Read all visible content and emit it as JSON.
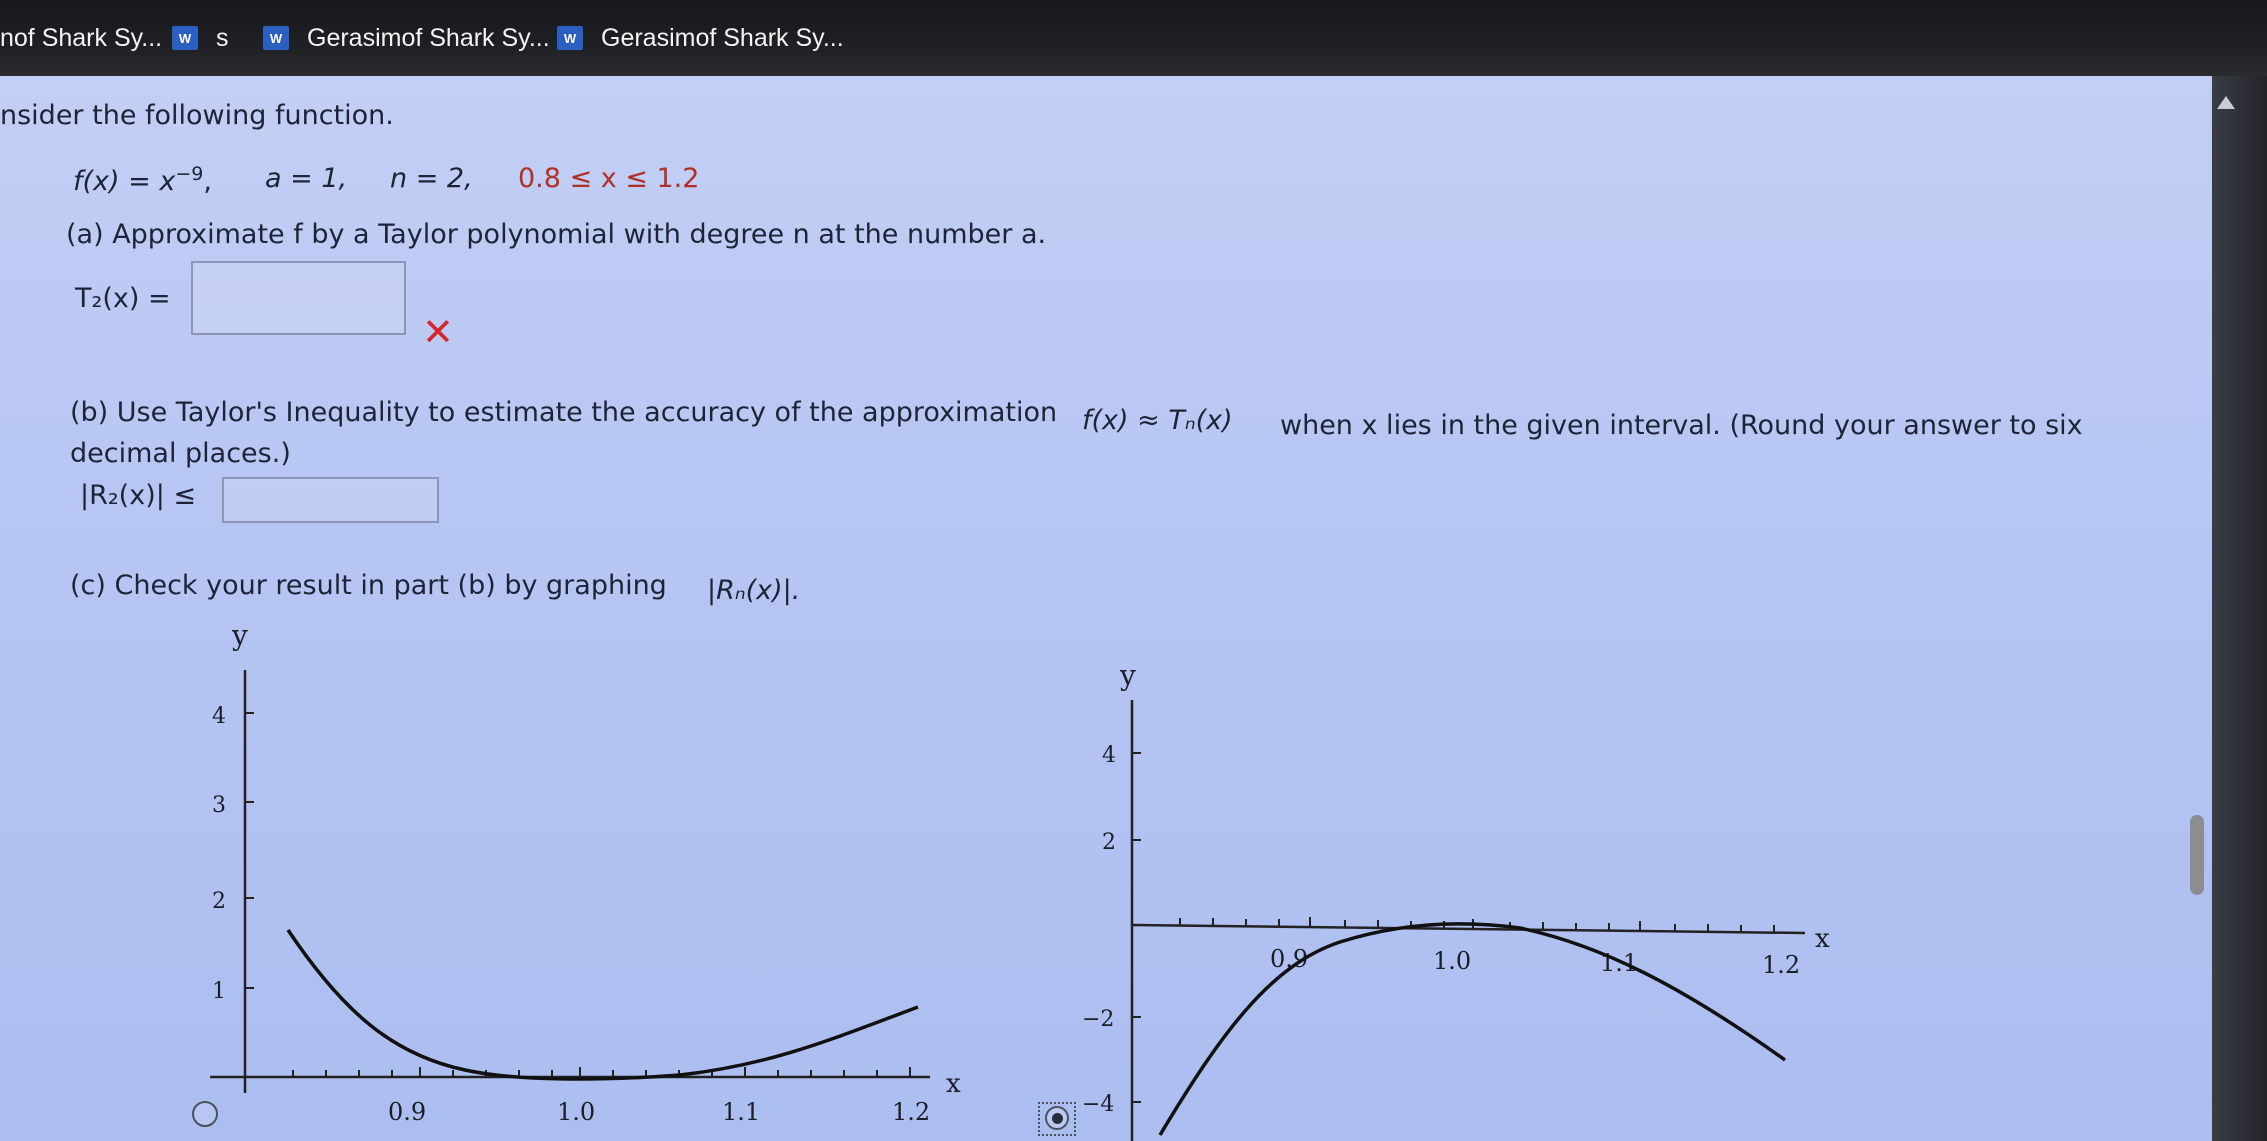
{
  "taskbar": {
    "tab1": "nof Shark Sy...",
    "tab2_icon": "word-icon",
    "tab2": "s",
    "tab3_icon": "word-icon",
    "tab3": "Gerasimof Shark Sy...",
    "tab4_icon": "word-icon",
    "tab4": "Gerasimof Shark Sy...",
    "icon_letter": "W"
  },
  "problem": {
    "intro": "nsider the following function.",
    "f_lhs": "f(x) = x",
    "f_exp": "−9",
    "f_comma": ",",
    "a_part": "a = 1,",
    "n_part": "n = 2,",
    "interval": "0.8 ≤ x ≤ 1.2"
  },
  "part_a": {
    "text": "(a) Approximate f by a Taylor polynomial with degree n at the number a.",
    "label": "T₂(x) =",
    "answer": "",
    "feedback": "✕"
  },
  "part_b": {
    "text": "(b) Use Taylor's Inequality to estimate the accuracy of the approximation",
    "formula": "f(x) ≈ Tₙ(x)",
    "text2": "when x lies in the given interval. (Round your answer to six",
    "text3": "decimal places.)",
    "label": "|R₂(x)| ≤",
    "answer": ""
  },
  "part_c": {
    "text": "(c) Check your result in part (b) by graphing",
    "formula": "|Rₙ(x)|."
  },
  "graph1": {
    "ylabel": "y",
    "xlabel": "x",
    "yticks": [
      "4",
      "3",
      "2",
      "1"
    ],
    "xticks": [
      "0.9",
      "1.0",
      "1.1",
      "1.2"
    ],
    "selected": false
  },
  "graph2": {
    "ylabel": "y",
    "xlabel": "x",
    "yticks": [
      "4",
      "2",
      "−2",
      "−4"
    ],
    "xticks": [
      "0.9",
      "1.0",
      "1.1",
      "1.2"
    ],
    "selected": true
  },
  "colors": {
    "panel": "#b7c6f3",
    "error": "#d4272b",
    "curve": "#111111"
  }
}
